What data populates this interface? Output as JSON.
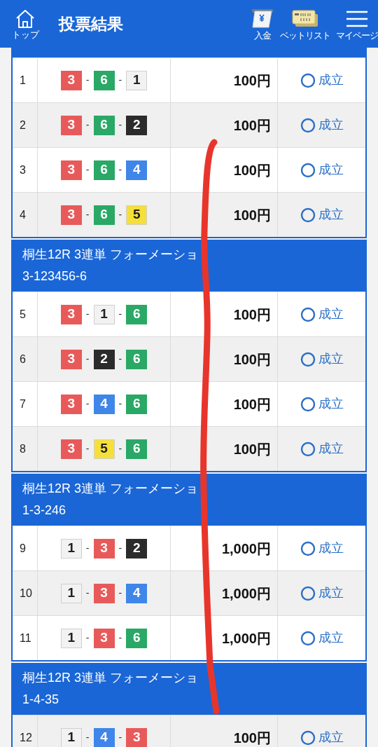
{
  "header": {
    "home_label": "トップ",
    "title": "投票結果",
    "actions": [
      {
        "kind": "deposit",
        "label": "入金"
      },
      {
        "kind": "betlist",
        "label": "ベットリスト"
      },
      {
        "kind": "menu",
        "label": "マイページ"
      }
    ]
  },
  "sections": [
    {
      "rows": [
        {
          "no": "1",
          "combo": [
            {
              "n": "3",
              "color": "#e85a5a"
            },
            {
              "sep": "-",
              "n": "6",
              "color": "#2aa866"
            },
            {
              "sep": "-",
              "n": "1",
              "color": "#f2f2f2"
            }
          ],
          "amount": "100円",
          "status": "成立"
        },
        {
          "no": "2",
          "combo": [
            {
              "n": "3",
              "color": "#e85a5a"
            },
            {
              "sep": "-",
              "n": "6",
              "color": "#2aa866"
            },
            {
              "sep": "-",
              "n": "2",
              "color": "#2b2b2b"
            }
          ],
          "amount": "100円",
          "status": "成立"
        },
        {
          "no": "3",
          "combo": [
            {
              "n": "3",
              "color": "#e85a5a"
            },
            {
              "sep": "-",
              "n": "6",
              "color": "#2aa866"
            },
            {
              "sep": "-",
              "n": "4",
              "color": "#3f86e8"
            }
          ],
          "amount": "100円",
          "status": "成立"
        },
        {
          "no": "4",
          "combo": [
            {
              "n": "3",
              "color": "#e85a5a"
            },
            {
              "sep": "-",
              "n": "6",
              "color": "#2aa866"
            },
            {
              "sep": "-",
              "n": "5",
              "color": "#f5e03a"
            }
          ],
          "amount": "100円",
          "status": "成立"
        }
      ]
    },
    {
      "title": "桐生12R 3連単 フォーメーショ",
      "subtitle": "3-123456-6",
      "rows": [
        {
          "no": "5",
          "combo": [
            {
              "n": "3",
              "color": "#e85a5a"
            },
            {
              "sep": "-",
              "n": "1",
              "color": "#f2f2f2"
            },
            {
              "sep": "-",
              "n": "6",
              "color": "#2aa866"
            }
          ],
          "amount": "100円",
          "status": "成立"
        },
        {
          "no": "6",
          "combo": [
            {
              "n": "3",
              "color": "#e85a5a"
            },
            {
              "sep": "-",
              "n": "2",
              "color": "#2b2b2b"
            },
            {
              "sep": "-",
              "n": "6",
              "color": "#2aa866"
            }
          ],
          "amount": "100円",
          "status": "成立"
        },
        {
          "no": "7",
          "combo": [
            {
              "n": "3",
              "color": "#e85a5a"
            },
            {
              "sep": "-",
              "n": "4",
              "color": "#3f86e8"
            },
            {
              "sep": "-",
              "n": "6",
              "color": "#2aa866"
            }
          ],
          "amount": "100円",
          "status": "成立"
        },
        {
          "no": "8",
          "combo": [
            {
              "n": "3",
              "color": "#e85a5a"
            },
            {
              "sep": "-",
              "n": "5",
              "color": "#f5e03a"
            },
            {
              "sep": "-",
              "n": "6",
              "color": "#2aa866"
            }
          ],
          "amount": "100円",
          "status": "成立"
        }
      ]
    },
    {
      "title": "桐生12R 3連単 フォーメーショ",
      "subtitle": "1-3-246",
      "rows": [
        {
          "no": "9",
          "combo": [
            {
              "n": "1",
              "color": "#f2f2f2"
            },
            {
              "sep": "-",
              "n": "3",
              "color": "#e85a5a"
            },
            {
              "sep": "-",
              "n": "2",
              "color": "#2b2b2b"
            }
          ],
          "amount": "1,000円",
          "status": "成立"
        },
        {
          "no": "10",
          "combo": [
            {
              "n": "1",
              "color": "#f2f2f2"
            },
            {
              "sep": "-",
              "n": "3",
              "color": "#e85a5a"
            },
            {
              "sep": "-",
              "n": "4",
              "color": "#3f86e8"
            }
          ],
          "amount": "1,000円",
          "status": "成立"
        },
        {
          "no": "11",
          "combo": [
            {
              "n": "1",
              "color": "#f2f2f2"
            },
            {
              "sep": "-",
              "n": "3",
              "color": "#e85a5a"
            },
            {
              "sep": "-",
              "n": "6",
              "color": "#2aa866"
            }
          ],
          "amount": "1,000円",
          "status": "成立"
        }
      ]
    },
    {
      "title": "桐生12R 3連単 フォーメーショ",
      "subtitle": "1-4-35",
      "rows": [
        {
          "no": "12",
          "combo": [
            {
              "n": "1",
              "color": "#f2f2f2"
            },
            {
              "sep": "-",
              "n": "4",
              "color": "#3f86e8"
            },
            {
              "sep": "-",
              "n": "3",
              "color": "#e85a5a"
            }
          ],
          "amount": "100円",
          "status": "成立"
        }
      ]
    }
  ]
}
